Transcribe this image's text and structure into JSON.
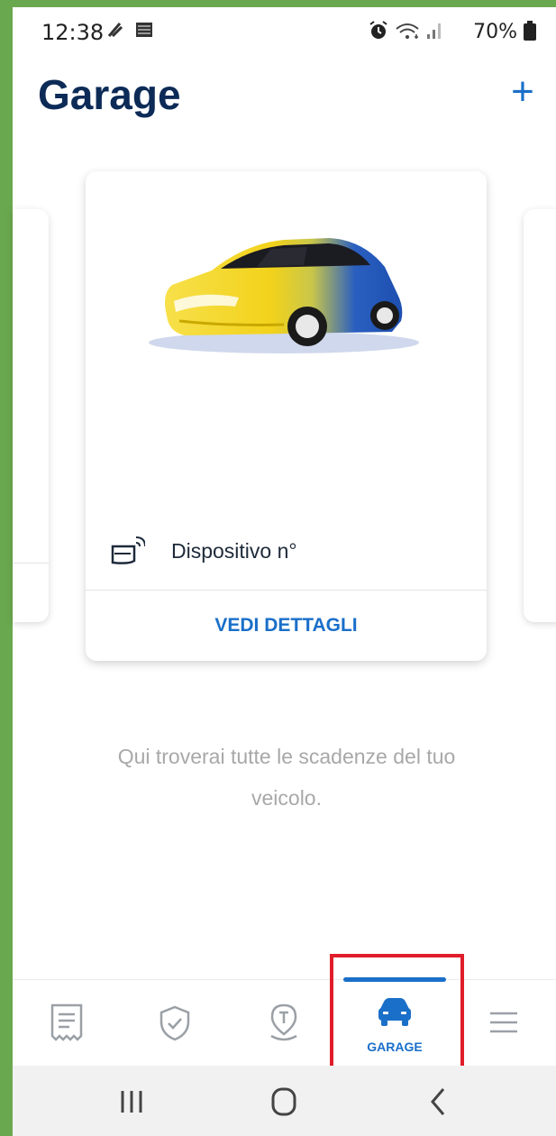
{
  "status_bar": {
    "time": "12:38",
    "battery": "70%",
    "icons": [
      "alarm-icon",
      "wifi-icon",
      "signal-icon",
      "battery-icon"
    ]
  },
  "header": {
    "title": "Garage",
    "add_label": "+"
  },
  "vehicle_card": {
    "device_label": "Dispositivo n°",
    "details_button": "VEDI DETTAGLI",
    "image_colors": [
      "#f2d21b",
      "#1d4fb0"
    ]
  },
  "empty_message": "Qui troverai tutte le scadenze del tuo veicolo.",
  "bottom_nav": {
    "items": [
      {
        "icon": "receipt-icon",
        "label": ""
      },
      {
        "icon": "shield-check-icon",
        "label": ""
      },
      {
        "icon": "map-pin-t-icon",
        "label": ""
      },
      {
        "icon": "car-icon",
        "label": "GARAGE",
        "active": true
      },
      {
        "icon": "menu-icon",
        "label": ""
      }
    ],
    "active_color": "#1a6fc9"
  },
  "system_nav": {
    "buttons": [
      "recent-apps-icon",
      "home-icon",
      "back-icon"
    ]
  }
}
